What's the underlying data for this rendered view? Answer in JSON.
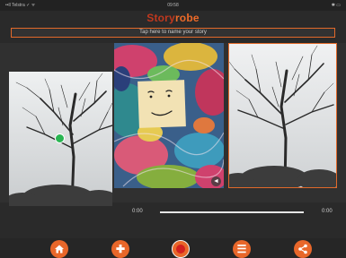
{
  "status": {
    "carrier": "••ll Telstra ✓ ᯤ",
    "time": "09:58",
    "battery": "✱ ▭"
  },
  "app": {
    "title_part1": "Story",
    "title_part2": "robe"
  },
  "story": {
    "name_placeholder": "Tap here to name your story"
  },
  "player": {
    "current_time": "0:00",
    "total_time": "0:00",
    "progress": 1.0
  },
  "toolbar": {
    "icons": [
      "home-icon",
      "plus-icon",
      "record-icon",
      "list-icon",
      "share-icon"
    ],
    "plus_glyph": "✚",
    "list_glyph": "☰"
  },
  "colors": {
    "accent": "#e8672a",
    "brand_red": "#c0381e",
    "marker_green": "#2ab552",
    "background": "#2a2a2a"
  }
}
